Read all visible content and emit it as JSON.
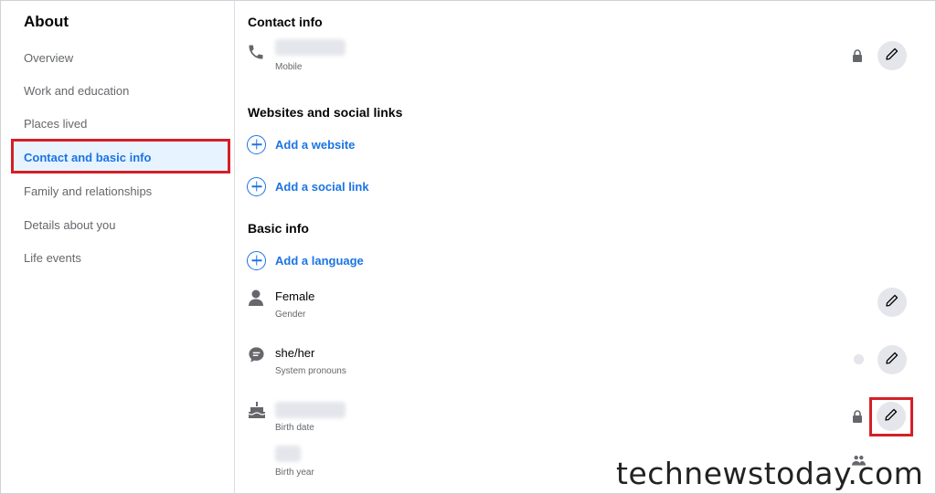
{
  "sidebar": {
    "title": "About",
    "items": [
      {
        "label": "Overview"
      },
      {
        "label": "Work and education"
      },
      {
        "label": "Places lived"
      },
      {
        "label": "Contact and basic info"
      },
      {
        "label": "Family and relationships"
      },
      {
        "label": "Details about you"
      },
      {
        "label": "Life events"
      }
    ]
  },
  "contact": {
    "title": "Contact info",
    "phone_label": "Mobile"
  },
  "websites": {
    "title": "Websites and social links",
    "add_website": "Add a website",
    "add_social": "Add a social link"
  },
  "basic": {
    "title": "Basic info",
    "add_language": "Add a language",
    "gender_value": "Female",
    "gender_label": "Gender",
    "pronouns_value": "she/her",
    "pronouns_label": "System pronouns",
    "birth_date_label": "Birth date",
    "birth_year_label": "Birth year"
  },
  "watermark": "technewstoday.com",
  "colors": {
    "accent": "#1b74e4",
    "highlight": "#d32027",
    "active_bg": "#e7f3ff"
  }
}
